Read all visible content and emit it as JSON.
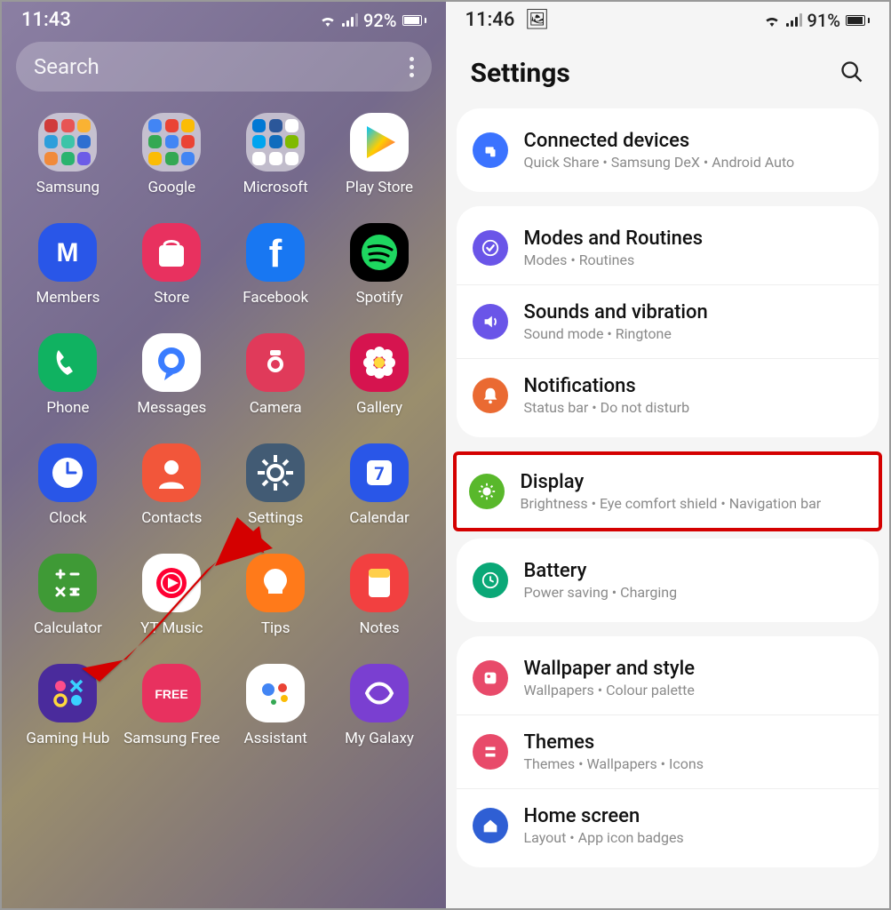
{
  "left": {
    "status": {
      "time": "11:43",
      "battery": "92%"
    },
    "search_placeholder": "Search",
    "apps": [
      {
        "label": "Samsung",
        "type": "folder",
        "minis": [
          "#d03b3b",
          "#e75555",
          "#f9b233",
          "#2e9edb",
          "#3cc4a8",
          "#2e6fd1",
          "#f18a3a",
          "#2ab36e",
          "#6c5ce7"
        ]
      },
      {
        "label": "Google",
        "type": "folder",
        "minis": [
          "#4285f4",
          "#ea4335",
          "#fbbc05",
          "#34a853",
          "#4285f4",
          "#ea4335",
          "#fbbc05",
          "#34a853",
          "#4285f4"
        ]
      },
      {
        "label": "Microsoft",
        "type": "folder",
        "minis": [
          "#0078d4",
          "#2b579a",
          "#ffffff",
          "#00a4ef",
          "#0f6cbd",
          "#7fba00",
          "#ffffff",
          "#ffffff",
          "#ffffff"
        ]
      },
      {
        "label": "Play Store",
        "bg": "#ffffff",
        "icon": "play"
      },
      {
        "label": "Members",
        "bg": "#2956e8",
        "icon": "M"
      },
      {
        "label": "Store",
        "bg": "#e8315f",
        "icon": "bag"
      },
      {
        "label": "Facebook",
        "bg": "#1877f2",
        "icon": "f"
      },
      {
        "label": "Spotify",
        "bg": "#000000",
        "icon": "spotify"
      },
      {
        "label": "Phone",
        "bg": "#10b261",
        "icon": "phone"
      },
      {
        "label": "Messages",
        "bg": "#ffffff",
        "icon": "msg"
      },
      {
        "label": "Camera",
        "bg": "#e03a5a",
        "icon": "camera"
      },
      {
        "label": "Gallery",
        "bg": "#d6144f",
        "icon": "flower"
      },
      {
        "label": "Clock",
        "bg": "#2956e8",
        "icon": "clock"
      },
      {
        "label": "Contacts",
        "bg": "#f2563a",
        "icon": "person"
      },
      {
        "label": "Settings",
        "bg": "#425b74",
        "icon": "gear"
      },
      {
        "label": "Calendar",
        "bg": "#2956e8",
        "icon": "7"
      },
      {
        "label": "Calculator",
        "bg": "#3f9a36",
        "icon": "calc"
      },
      {
        "label": "YT Music",
        "bg": "#ffffff",
        "icon": "ytm"
      },
      {
        "label": "Tips",
        "bg": "#ff7a1a",
        "icon": "bulb"
      },
      {
        "label": "Notes",
        "bg": "#f24040",
        "icon": "notes"
      },
      {
        "label": "Gaming Hub",
        "bg": "#4a2b9c",
        "icon": "oxo"
      },
      {
        "label": "Samsung Free",
        "bg": "#e8315f",
        "icon": "FREE"
      },
      {
        "label": "Assistant",
        "bg": "#ffffff",
        "icon": "assist"
      },
      {
        "label": "My Galaxy",
        "bg": "#7a3fd1",
        "icon": "galaxy"
      }
    ]
  },
  "right": {
    "status": {
      "time": "11:46",
      "battery": "91%"
    },
    "title": "Settings",
    "groups": [
      {
        "rows": [
          {
            "icon": "devices",
            "color": "#3b73ff",
            "title": "Connected devices",
            "sub": "Quick Share  •  Samsung DeX  •  Android Auto"
          }
        ]
      },
      {
        "rows": [
          {
            "icon": "check-badge",
            "color": "#6a55e8",
            "title": "Modes and Routines",
            "sub": "Modes  •  Routines"
          },
          {
            "icon": "sound",
            "color": "#6a55e8",
            "title": "Sounds and vibration",
            "sub": "Sound mode  •  Ringtone"
          },
          {
            "icon": "bell",
            "color": "#ea6a32",
            "title": "Notifications",
            "sub": "Status bar  •  Do not disturb"
          }
        ]
      },
      {
        "highlighted": true,
        "rows": [
          {
            "icon": "sun",
            "color": "#59b82b",
            "title": "Display",
            "sub": "Brightness  •  Eye comfort shield  •  Navigation bar"
          }
        ]
      },
      {
        "rows": [
          {
            "icon": "battery",
            "color": "#0aa877",
            "title": "Battery",
            "sub": "Power saving  •  Charging"
          }
        ]
      },
      {
        "rows": [
          {
            "icon": "palette",
            "color": "#e84a6a",
            "title": "Wallpaper and style",
            "sub": "Wallpapers  •  Colour palette"
          },
          {
            "icon": "brush",
            "color": "#e84a6a",
            "title": "Themes",
            "sub": "Themes  •  Wallpapers  •  Icons"
          },
          {
            "icon": "home",
            "color": "#2f5fd4",
            "title": "Home screen",
            "sub": "Layout  •  App icon badges"
          }
        ]
      }
    ]
  }
}
